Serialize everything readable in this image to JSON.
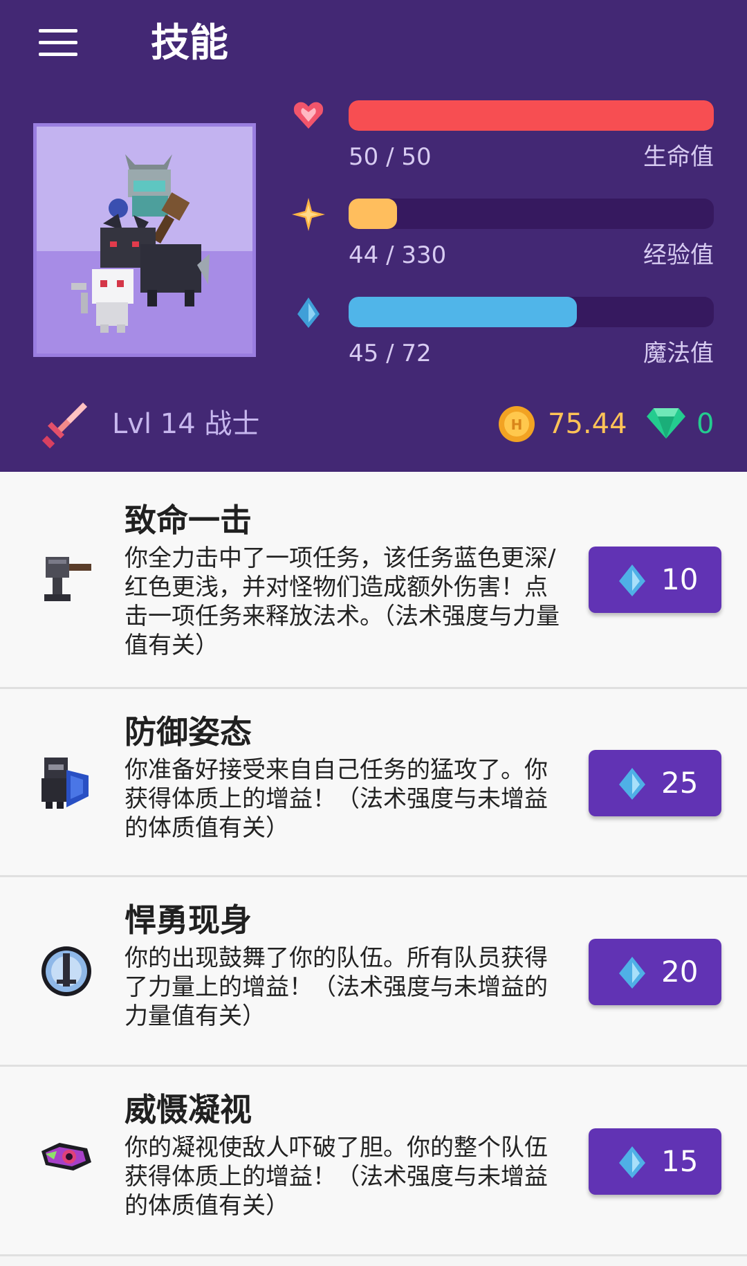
{
  "app": {
    "title": "技能"
  },
  "stats": {
    "health": {
      "value": "50 / 50",
      "label": "生命值",
      "fraction": 1.0,
      "color": "#f74e52"
    },
    "experience": {
      "value": "44 / 330",
      "label": "经验值",
      "fraction": 0.133,
      "color": "#ffbe5d"
    },
    "mana": {
      "value": "45 / 72",
      "label": "魔法值",
      "fraction": 0.625,
      "color": "#50b5e9"
    }
  },
  "profile": {
    "level": "Lvl 14 战士",
    "gold": "75.44",
    "gems": "0"
  },
  "skills": [
    {
      "name": "致命一击",
      "description": "你全力击中了一项任务，该任务蓝色更深/红色更浅，并对怪物们造成额外伤害！点击一项任务来释放法术。（法术强度与力量值有关）",
      "cost": "10",
      "icon": "hammer-icon"
    },
    {
      "name": "防御姿态",
      "description": "你准备好接受来自自己任务的猛攻了。你获得体质上的增益！（法术强度与未增益的体质值有关）",
      "cost": "25",
      "icon": "shield-knight-icon"
    },
    {
      "name": "悍勇现身",
      "description": "你的出现鼓舞了你的队伍。所有队员获得了力量上的增益！（法术强度与未增益的力量值有关）",
      "cost": "20",
      "icon": "sword-emblem-icon"
    },
    {
      "name": "威慑凝视",
      "description": "你的凝视使敌人吓破了胆。你的整个队伍获得体质上的增益！（法术强度与未增益的体质值有关）",
      "cost": "15",
      "icon": "evil-eye-icon"
    }
  ],
  "colors": {
    "header_bg": "#432874",
    "button_bg": "#6133b4",
    "gold": "#ffc357",
    "gem": "#24cc8f"
  }
}
